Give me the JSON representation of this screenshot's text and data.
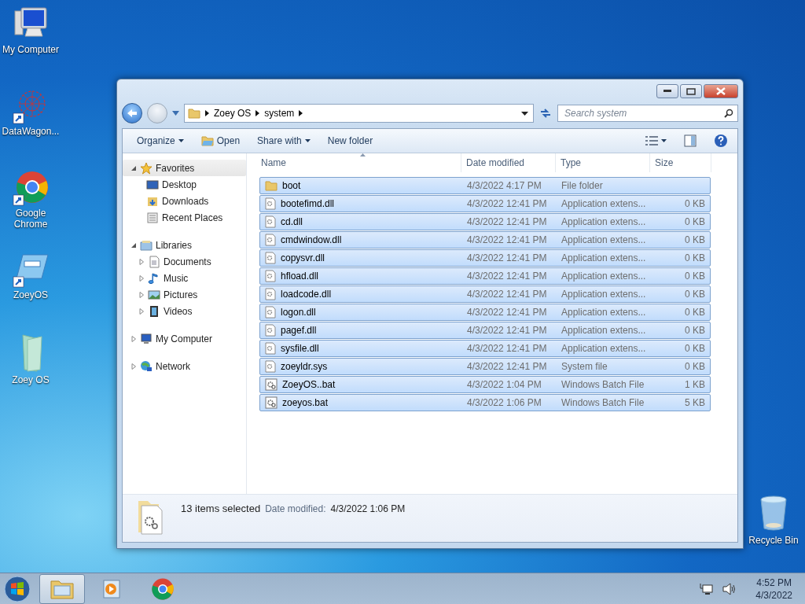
{
  "desktop_icons": [
    {
      "label": "My Computer",
      "kind": "computer"
    },
    {
      "label": "DataWagon...",
      "kind": "network-app"
    },
    {
      "label": "Google Chrome",
      "kind": "chrome"
    },
    {
      "label": "ZoeyOS",
      "kind": "drive"
    },
    {
      "label": "Zoey OS",
      "kind": "folder"
    }
  ],
  "recycle_bin": {
    "label": "Recycle Bin"
  },
  "window": {
    "address": {
      "crumbs": [
        "Zoey OS",
        "system"
      ]
    },
    "search": {
      "placeholder": "Search system"
    },
    "toolbar": [
      {
        "label": "Organize",
        "kind": "menu"
      },
      {
        "label": "Open",
        "kind": "open"
      },
      {
        "label": "Share with",
        "kind": "menu"
      },
      {
        "label": "New folder",
        "kind": "plain"
      }
    ],
    "nav": [
      {
        "label": "Favorites",
        "kind": "favorites",
        "expanded": true,
        "highlighted": true,
        "children": [
          {
            "label": "Desktop",
            "kind": "desktop"
          },
          {
            "label": "Downloads",
            "kind": "downloads"
          },
          {
            "label": "Recent Places",
            "kind": "recent"
          }
        ]
      },
      {
        "label": "Libraries",
        "kind": "libraries",
        "expanded": true,
        "highlighted": false,
        "children": [
          {
            "label": "Documents",
            "kind": "documents",
            "expanded": false
          },
          {
            "label": "Music",
            "kind": "music",
            "expanded": false
          },
          {
            "label": "Pictures",
            "kind": "pictures",
            "expanded": false
          },
          {
            "label": "Videos",
            "kind": "videos",
            "expanded": false
          }
        ]
      },
      {
        "label": "My Computer",
        "kind": "computer",
        "expanded": false,
        "highlighted": false
      },
      {
        "label": "Network",
        "kind": "network",
        "expanded": false,
        "highlighted": false
      }
    ],
    "columns": [
      {
        "label": "Name",
        "sorted": true
      },
      {
        "label": "Date modified",
        "sorted": false
      },
      {
        "label": "Type",
        "sorted": false
      },
      {
        "label": "Size",
        "sorted": false
      }
    ],
    "rows": [
      {
        "name": "boot",
        "date": "4/3/2022 4:17 PM",
        "type": "File folder",
        "kind": "folder",
        "selected": true
      },
      {
        "name": "bootefimd.dll",
        "date": "4/3/2022 12:41 PM",
        "type": "Application extens...",
        "size": "0 KB",
        "kind": "dll",
        "selected": true
      },
      {
        "name": "cd.dll",
        "date": "4/3/2022 12:41 PM",
        "type": "Application extens...",
        "size": "0 KB",
        "kind": "dll",
        "selected": true
      },
      {
        "name": "cmdwindow.dll",
        "date": "4/3/2022 12:41 PM",
        "type": "Application extens...",
        "size": "0 KB",
        "kind": "dll",
        "selected": true
      },
      {
        "name": "copysvr.dll",
        "date": "4/3/2022 12:41 PM",
        "type": "Application extens...",
        "size": "0 KB",
        "kind": "dll",
        "selected": true
      },
      {
        "name": "hfload.dll",
        "date": "4/3/2022 12:41 PM",
        "type": "Application extens...",
        "size": "0 KB",
        "kind": "dll",
        "selected": true
      },
      {
        "name": "loadcode.dll",
        "date": "4/3/2022 12:41 PM",
        "type": "Application extens...",
        "size": "0 KB",
        "kind": "dll",
        "selected": true
      },
      {
        "name": "logon.dll",
        "date": "4/3/2022 12:41 PM",
        "type": "Application extens...",
        "size": "0 KB",
        "kind": "dll",
        "selected": true
      },
      {
        "name": "pagef.dll",
        "date": "4/3/2022 12:41 PM",
        "type": "Application extens...",
        "size": "0 KB",
        "kind": "dll",
        "selected": true
      },
      {
        "name": "sysfile.dll",
        "date": "4/3/2022 12:41 PM",
        "type": "Application extens...",
        "size": "0 KB",
        "kind": "dll",
        "selected": true
      },
      {
        "name": "zoeyldr.sys",
        "date": "4/3/2022 12:41 PM",
        "type": "System file",
        "size": "0 KB",
        "kind": "sys",
        "selected": true
      },
      {
        "name": "ZoeyOS..bat",
        "date": "4/3/2022 1:04 PM",
        "type": "Windows Batch File",
        "size": "1 KB",
        "kind": "bat",
        "selected": true
      },
      {
        "name": "zoeyos.bat",
        "date": "4/3/2022 1:06 PM",
        "type": "Windows Batch File",
        "size": "5 KB",
        "kind": "bat",
        "selected": true
      }
    ],
    "details": {
      "summary": "13 items selected",
      "label": "Date modified:",
      "value": "4/3/2022 1:06 PM"
    }
  },
  "taskbar": {
    "items": [
      {
        "kind": "explorer",
        "selected": true
      },
      {
        "kind": "media",
        "selected": false
      },
      {
        "kind": "chrome",
        "selected": false
      }
    ],
    "time": "4:52 PM",
    "date": "4/3/2022"
  }
}
